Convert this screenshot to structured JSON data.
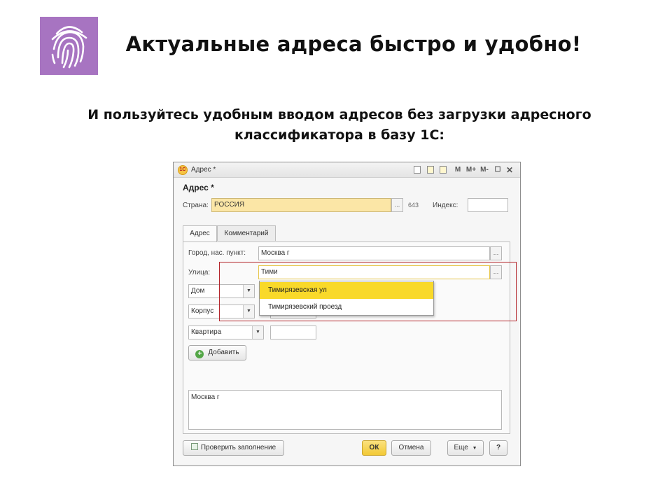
{
  "slide": {
    "title": "Актуальные адреса быстро и удобно!",
    "subtitle_line1": "И пользуйтесь удобным вводом адресов без загрузки адресного",
    "subtitle_line2": "классификатора в базу 1С:"
  },
  "colors": {
    "logo_bg": "#a774c1",
    "accent_yellow": "#f9d92a",
    "highlight_red": "#b3242a"
  },
  "window": {
    "title": "Адрес *",
    "app_icon": "1С",
    "toolbar": {
      "m": "M",
      "m_plus": "M+",
      "m_minus": "M-"
    },
    "heading": "Адрес *",
    "country_label": "Страна:",
    "country_value": "РОССИЯ",
    "country_code": "643",
    "index_label": "Индекс:",
    "index_value": "",
    "tabs": [
      {
        "label": "Адрес"
      },
      {
        "label": "Комментарий"
      }
    ],
    "city_label": "Город, нас. пункт:",
    "city_value": "Москва г",
    "street_label": "Улица:",
    "street_value": "Тими",
    "suggestions": [
      "Тимирязевская ул",
      "Тимирязевский проезд"
    ],
    "house_type": "Дом",
    "building_type": "Корпус",
    "apartment_type": "Квартира",
    "add_button": "Добавить",
    "memo_text": "Москва г",
    "check_button": "Проверить заполнение",
    "ok_button": "ОК",
    "cancel_button": "Отмена",
    "more_button": "Еще",
    "help_button": "?",
    "ellipsis": "..."
  }
}
